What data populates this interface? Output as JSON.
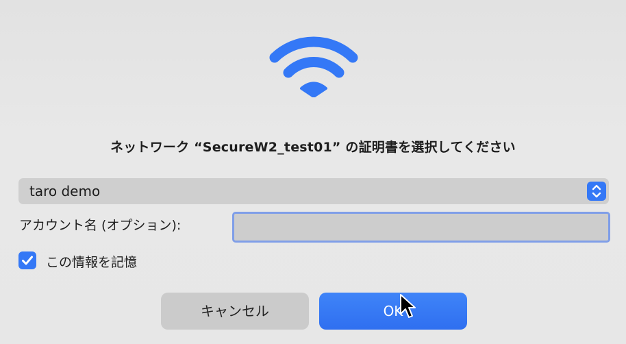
{
  "dialog": {
    "title": "ネットワーク “SecureW2_test01” の証明書を選択してください",
    "icon": "wifi-icon",
    "accent_color": "#3478f6"
  },
  "certificate_select": {
    "selected": "taro demo"
  },
  "account": {
    "label": "アカウント名 (オプション):",
    "value": ""
  },
  "remember": {
    "label": "この情報を記憶",
    "checked": true
  },
  "buttons": {
    "cancel": "キャンセル",
    "ok": "OK"
  }
}
